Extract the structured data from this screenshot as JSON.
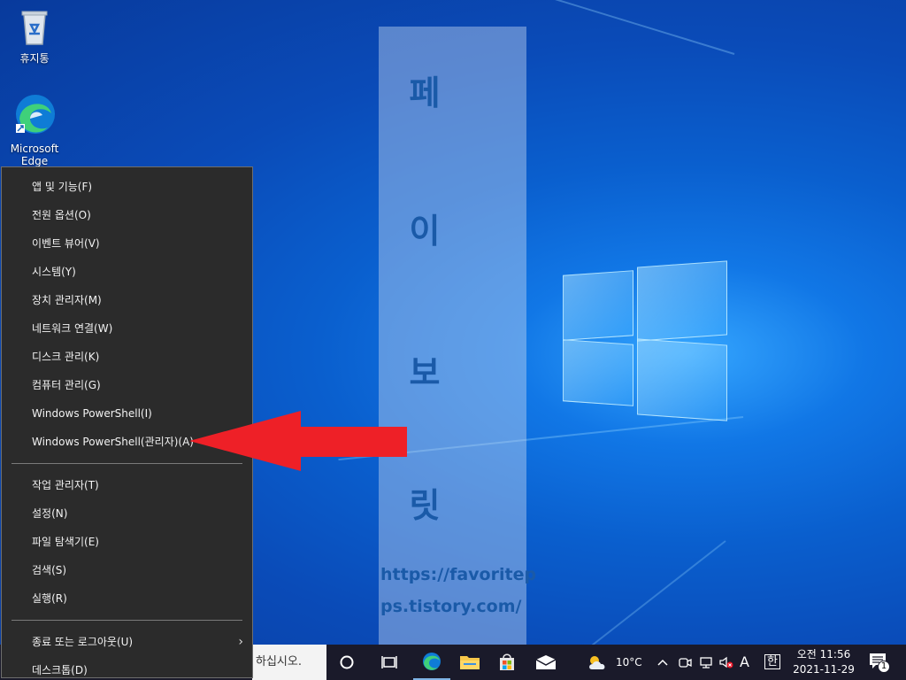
{
  "desktop": {
    "icons": [
      {
        "label": "휴지통"
      },
      {
        "label_line1": "Microsoft",
        "label_line2": "Edge"
      }
    ]
  },
  "watermark": {
    "chars": [
      "페",
      "이",
      "보",
      "릿"
    ],
    "url_line1": "https://favoritep",
    "url_line2": "ps.tistory.com/"
  },
  "context_menu": {
    "group1": [
      "앱 및 기능(F)",
      "전원 옵션(O)",
      "이벤트 뷰어(V)",
      "시스템(Y)",
      "장치 관리자(M)",
      "네트워크 연결(W)",
      "디스크 관리(K)",
      "컴퓨터 관리(G)",
      "Windows PowerShell(I)",
      "Windows PowerShell(관리자)(A)"
    ],
    "group2": [
      "작업 관리자(T)",
      "설정(N)",
      "파일 탐색기(E)",
      "검색(S)",
      "실행(R)"
    ],
    "group3": [
      "종료 또는 로그아웃(U)",
      "데스크톱(D)"
    ],
    "submenu_chevron": "›"
  },
  "taskbar": {
    "search_placeholder": "하십시오.",
    "weather_temp": "10°C",
    "ime_label": "A",
    "ime_korean": "한",
    "clock_time": "오전 11:56",
    "clock_date": "2021-11-29",
    "notification_count": "1"
  },
  "colors": {
    "menu_bg": "#2b2b2b",
    "arrow_red": "#ee2027",
    "taskbar_bg": "#1a1a2a"
  }
}
